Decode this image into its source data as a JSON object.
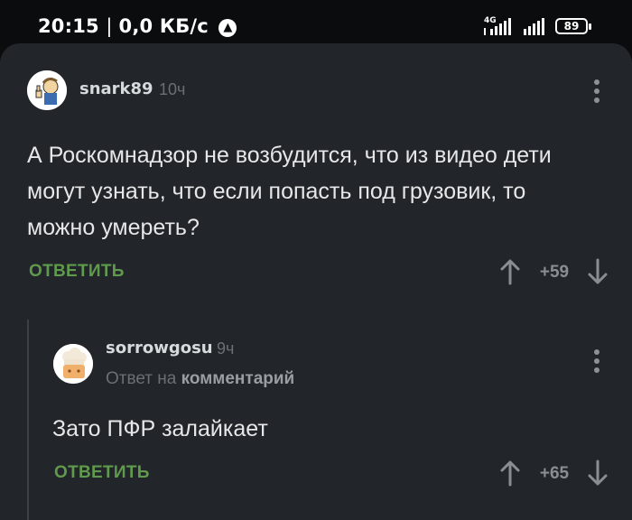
{
  "status_bar": {
    "time": "20:15",
    "net_speed": "0,0 КБ/с",
    "network_type": "4G",
    "battery": "89"
  },
  "comments": [
    {
      "author": "snark89",
      "time": "10ч",
      "avatar_icon": "vault-boy-thumbs-up-avatar",
      "text": "А Роскомнадзор не возбудится, что из видео дети могут узнать, что если попасть под грузовик, то можно умереть?",
      "reply_label": "ОТВЕТИТЬ",
      "score": "+59"
    },
    {
      "author": "sorrowgosu",
      "time": "9ч",
      "avatar_icon": "chef-avatar",
      "reply_to_prefix": "Ответ на",
      "reply_to_target": "комментарий",
      "text": "Зато ПФР залайкает",
      "reply_label": "ОТВЕТИТЬ",
      "score": "+65"
    }
  ],
  "colors": {
    "background": "#222529",
    "accent_reply": "#5f9a4d",
    "text": "#e6e7e8",
    "muted": "#6b7075"
  }
}
